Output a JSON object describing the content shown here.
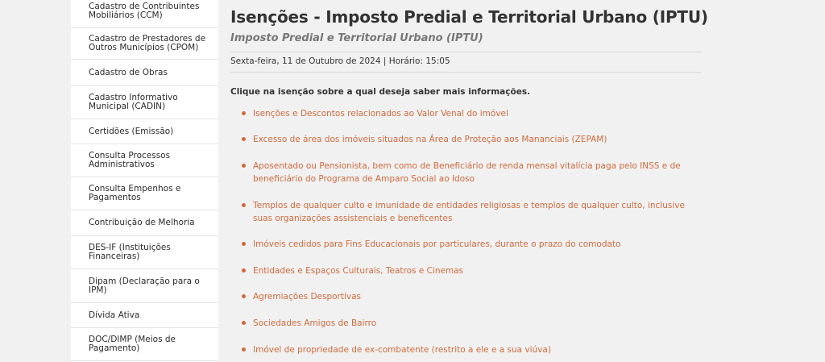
{
  "sidebar": {
    "items": [
      {
        "label": "Cadastro de Contribuintes Mobiliários (CCM)"
      },
      {
        "label": "Cadastro de Prestadores de Outros Municípios (CPOM)"
      },
      {
        "label": "Cadastro de Obras"
      },
      {
        "label": "Cadastro Informativo Municipal (CADIN)"
      },
      {
        "label": "Certidões (Emissão)"
      },
      {
        "label": "Consulta Processos Administrativos"
      },
      {
        "label": "Consulta Empenhos e Pagamentos"
      },
      {
        "label": "Contribuição de Melhoria"
      },
      {
        "label": "DES-IF (Instituições Financeiras)"
      },
      {
        "label": "Dipam (Declaração para o IPM)"
      },
      {
        "label": "Dívida Ativa"
      },
      {
        "label": "DOC/DIMP (Meios de Pagamento)"
      }
    ]
  },
  "main": {
    "title": "Isenções - Imposto Predial e Territorial Urbano (IPTU)",
    "subtitle": "Imposto Predial e Territorial Urbano (IPTU)",
    "date_line": "Sexta-feira, 11 de Outubro de 2024 | Horário: 15:05",
    "instruction": "Clique na isenção sobre a qual deseja saber mais informações.",
    "exemptions": [
      {
        "label": "Isenções e Descontos relacionados ao Valor Venal do imóvel"
      },
      {
        "label": "Excesso de área dos imóveis situados na Área de Proteção aos Mananciais (ZEPAM)"
      },
      {
        "label": "Aposentado ou Pensionista, bem como de Beneficiário de renda mensal vitalícia paga pelo INSS e de beneficiário do Programa de Amparo Social ao Idoso"
      },
      {
        "label": "Templos de qualquer culto e imunidade de entidades religiosas e templos de qualquer culto, inclusive suas organizações assistenciais e beneficentes"
      },
      {
        "label": "Imóveis cedidos para Fins Educacionais por particulares, durante o prazo do comodato"
      },
      {
        "label": "Entidades e Espaços Culturais, Teatros e Cinemas"
      },
      {
        "label": "Agremiações Desportivas"
      },
      {
        "label": "Sociedades Amigos de Bairro"
      },
      {
        "label": "Imóvel de propriedade de ex-combatente (restrito a ele e a sua viúva)"
      }
    ]
  },
  "colors": {
    "page_background": "#f1f1f1",
    "sidebar_background": "#ffffff",
    "link_color": "#cf6a3c",
    "text_color": "#333333"
  }
}
